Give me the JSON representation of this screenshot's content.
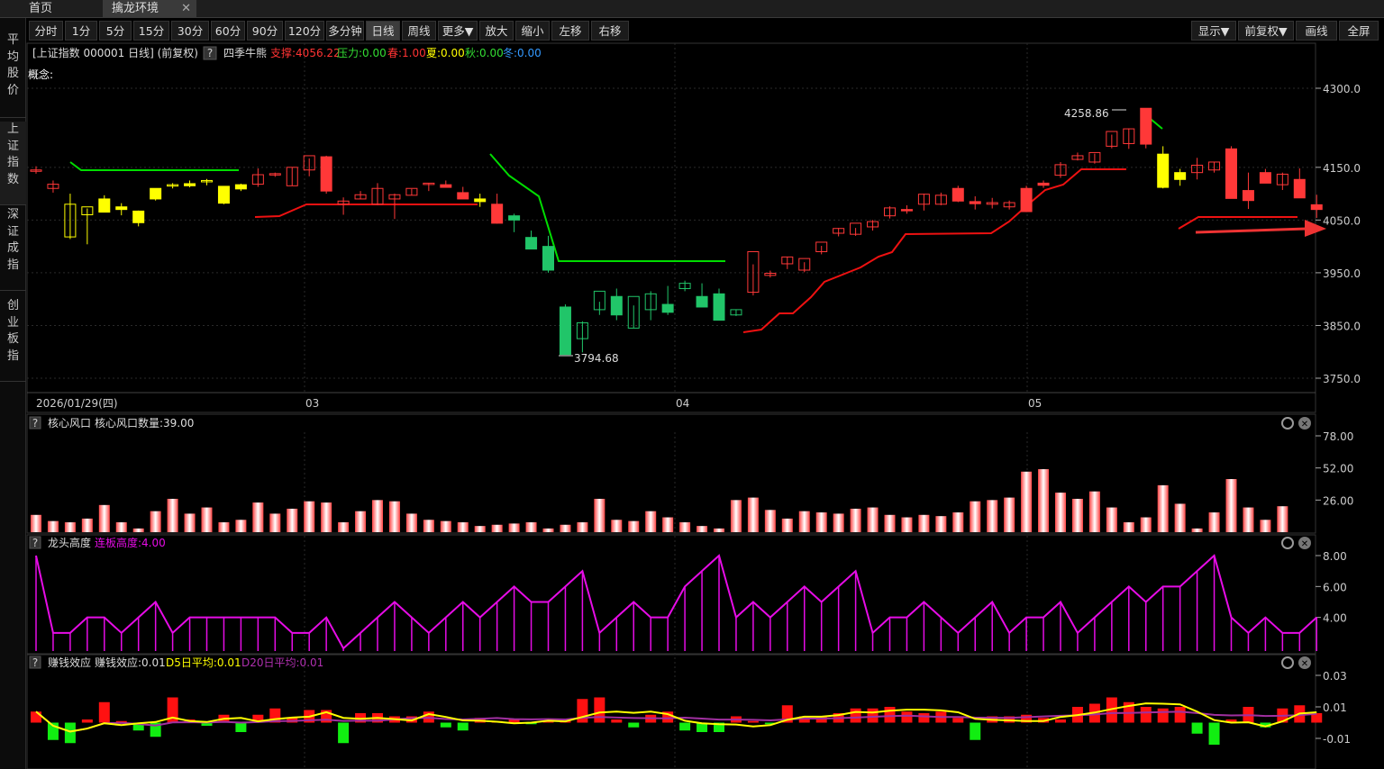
{
  "tabs": {
    "home": "首页",
    "env": "擒龙环境",
    "close": "✕"
  },
  "sidebar": [
    "平\n均\n股\n价",
    "上\n证\n指\n数",
    "深\n证\n成\n指",
    "创\n业\n板\n指"
  ],
  "toolbar": {
    "left": [
      "分时",
      "1分",
      "5分",
      "15分",
      "30分",
      "60分",
      "90分",
      "120分",
      "多分钟",
      "日线",
      "周线",
      "更多▼",
      "放大",
      "缩小",
      "左移",
      "右移"
    ],
    "active": "日线",
    "right": [
      "显示▼",
      "前复权▼",
      "画线",
      "全屏"
    ]
  },
  "colors": {
    "up": "#ff3838",
    "down": "#21c569",
    "yellow": "#ffff00",
    "magenta": "#e60ce6",
    "green_line": "#00dd00",
    "red_line": "#ee1111"
  },
  "main": {
    "title": "[上证指数 000001 日线] (前复权)",
    "indicator_name": "四季牛熊",
    "help": "?",
    "support": "支撑:4056.22",
    "pressure": "压力:0.00",
    "spring": "春:1.00",
    "summer": "夏:0.00",
    "autumn": "秋:0.00",
    "winter": "冬:0.00",
    "concept": "概念:",
    "high_label": "4258.86",
    "low_label": "3794.68"
  },
  "x_labels": {
    "first": "2026/01/29(四)",
    "m3": "03",
    "m4": "04",
    "m5": "05"
  },
  "panels": [
    {
      "label": "核心风口",
      "value": "核心风口数量:39.00",
      "yticks": [
        "78.00",
        "52.00",
        "26.00"
      ]
    },
    {
      "label": "龙头高度",
      "value": "连板高度:4.00",
      "yticks": [
        "8.00",
        "6.00",
        "4.00"
      ]
    },
    {
      "label": "赚钱效应",
      "value": "赚钱效应:0.01",
      "d5": "D5日平均:0.01",
      "d20": "D20日平均:0.01",
      "yticks": [
        "0.03",
        "0.01",
        "-0.01"
      ]
    }
  ],
  "chart_data": {
    "type": "candlestick",
    "y_ticks": [
      4300,
      4150,
      4050,
      3950,
      3850,
      3750
    ],
    "ohlc": [
      [
        4145,
        4152,
        4138,
        4145
      ],
      [
        4110,
        4125,
        4102,
        4118
      ],
      [
        4080,
        4100,
        4014,
        4018
      ],
      [
        4060,
        4072,
        4004,
        4075
      ],
      [
        4090,
        4097,
        4068,
        4065
      ],
      [
        4075,
        4082,
        4059,
        4070
      ],
      [
        4045,
        4068,
        4038,
        4067
      ],
      [
        4090,
        4103,
        4087,
        4110
      ],
      [
        4115,
        4120,
        4110,
        4117
      ],
      [
        4115,
        4125,
        4112,
        4119
      ],
      [
        4125,
        4128,
        4116,
        4123
      ],
      [
        4082,
        4112,
        4080,
        4114
      ],
      [
        4109,
        4119,
        4105,
        4117
      ],
      [
        4118,
        4148,
        4113,
        4136
      ],
      [
        4136,
        4140,
        4132,
        4138
      ],
      [
        4115,
        4150,
        4115,
        4150
      ],
      [
        4145,
        4167,
        4133,
        4172
      ],
      [
        4170,
        4172,
        4100,
        4105
      ],
      [
        4080,
        4093,
        4060,
        4086
      ],
      [
        4090,
        4105,
        4090,
        4098
      ],
      [
        4080,
        4120,
        4078,
        4110
      ],
      [
        4090,
        4100,
        4052,
        4098
      ],
      [
        4097,
        4109,
        4097,
        4110
      ],
      [
        4118,
        4120,
        4105,
        4120
      ],
      [
        4117,
        4125,
        4112,
        4112
      ],
      [
        4102,
        4113,
        4094,
        4090
      ],
      [
        4090,
        4100,
        4075,
        4085
      ],
      [
        4080,
        4100,
        4043,
        4044
      ],
      [
        4058,
        4062,
        4027,
        4050
      ],
      [
        4017,
        4030,
        3995,
        3995
      ],
      [
        4000,
        4020,
        3950,
        3955
      ],
      [
        3885,
        3890,
        3795,
        3795
      ],
      [
        3825,
        3858,
        3799,
        3855
      ],
      [
        3880,
        3895,
        3870,
        3915
      ],
      [
        3905,
        3920,
        3860,
        3870
      ],
      [
        3845,
        3888,
        3845,
        3905
      ],
      [
        3880,
        3915,
        3860,
        3910
      ],
      [
        3890,
        3925,
        3870,
        3875
      ],
      [
        3920,
        3935,
        3915,
        3930
      ],
      [
        3905,
        3930,
        3898,
        3885
      ],
      [
        3910,
        3920,
        3860,
        3860
      ],
      [
        3870,
        3880,
        3868,
        3880
      ],
      [
        3913,
        3966,
        3907,
        3990
      ],
      [
        3945,
        3954,
        3941,
        3949
      ],
      [
        3967,
        3980,
        3957,
        3980
      ],
      [
        3955,
        3970,
        3951,
        3977
      ],
      [
        3990,
        4001,
        3985,
        4008
      ],
      [
        4025,
        4035,
        4019,
        4034
      ],
      [
        4023,
        4035,
        4020,
        4044
      ],
      [
        4037,
        4050,
        4030,
        4047
      ],
      [
        4058,
        4076,
        4053,
        4073
      ],
      [
        4070,
        4078,
        4062,
        4068
      ],
      [
        4080,
        4100,
        4068,
        4099
      ],
      [
        4080,
        4102,
        4078,
        4097
      ],
      [
        4110,
        4115,
        4084,
        4086
      ],
      [
        4085,
        4095,
        4070,
        4081
      ],
      [
        4080,
        4092,
        4072,
        4083
      ],
      [
        4075,
        4087,
        4070,
        4083
      ],
      [
        4110,
        4115,
        4065,
        4066
      ],
      [
        4120,
        4125,
        4111,
        4116
      ],
      [
        4135,
        4160,
        4130,
        4155
      ],
      [
        4165,
        4178,
        4163,
        4172
      ],
      [
        4160,
        4176,
        4157,
        4178
      ],
      [
        4190,
        4212,
        4186,
        4218
      ],
      [
        4195,
        4224,
        4185,
        4223
      ],
      [
        4262,
        4258,
        4186,
        4194
      ],
      [
        4175,
        4190,
        4110,
        4112
      ],
      [
        4140,
        4147,
        4115,
        4127
      ],
      [
        4140,
        4168,
        4127,
        4154
      ],
      [
        4145,
        4160,
        4140,
        4160
      ],
      [
        4185,
        4190,
        4100,
        4091
      ],
      [
        4106,
        4140,
        4071,
        4087
      ],
      [
        4140,
        4147,
        4122,
        4120
      ],
      [
        4117,
        4140,
        4107,
        4137
      ],
      [
        4127,
        4148,
        4101,
        4092
      ],
      [
        4079,
        4098,
        4054,
        4070
      ]
    ],
    "support_line": "red line rising from ~3845 to ~4140, ends ~4056",
    "pressure_lines": "green line segments",
    "core_windows": [
      14,
      9,
      8,
      11,
      22,
      8,
      3,
      17,
      27,
      15,
      20,
      8,
      10,
      24,
      15,
      19,
      25,
      24,
      8,
      17,
      26,
      25,
      15,
      10,
      9,
      8,
      5,
      6,
      7,
      8,
      3,
      6,
      8,
      27,
      10,
      9,
      17,
      12,
      8,
      5,
      3,
      26,
      28,
      18,
      11,
      17,
      16,
      15,
      19,
      20,
      14,
      12,
      14,
      13,
      16,
      25,
      26,
      28,
      49,
      51,
      32,
      27,
      33,
      20,
      8,
      12,
      38,
      23,
      3,
      16,
      43,
      20,
      10,
      21
    ],
    "dragon_height": [
      8,
      3,
      3,
      4,
      4,
      3,
      4,
      5,
      3,
      4,
      4,
      4,
      4,
      4,
      4,
      3,
      3,
      4,
      2,
      3,
      4,
      5,
      4,
      3,
      4,
      5,
      4,
      5,
      6,
      5,
      5,
      6,
      7,
      3,
      4,
      5,
      4,
      4,
      6,
      7,
      8,
      4,
      5,
      4,
      5,
      6,
      5,
      6,
      7,
      3,
      4,
      4,
      5,
      4,
      3,
      4,
      5,
      3,
      4,
      4,
      5,
      3,
      4,
      5,
      6,
      5,
      6,
      6,
      7,
      8,
      4,
      3,
      4,
      3,
      3,
      4
    ],
    "money_effect": [
      0.007,
      -0.011,
      -0.013,
      0.002,
      0.013,
      0.001,
      -0.005,
      -0.009,
      0.016,
      0.002,
      -0.002,
      0.005,
      -0.006,
      0.005,
      0.009,
      0.003,
      0.008,
      0.008,
      -0.013,
      0.006,
      0.006,
      0.004,
      0.004,
      0.007,
      -0.003,
      -0.005,
      0.003,
      0.001,
      0.002,
      -0.001,
      0.001,
      0.001,
      0.015,
      0.016,
      0.002,
      -0.003,
      0.005,
      0.007,
      -0.005,
      -0.006,
      -0.006,
      0.004,
      0.001,
      -0.001,
      0.011,
      0.004,
      0.004,
      0.006,
      0.009,
      0.009,
      0.01,
      0.007,
      0.006,
      0.007,
      0.003,
      -0.011,
      0.004,
      0.004,
      0.005,
      0.003,
      0.002,
      0.01,
      0.012,
      0.016,
      0.013,
      0.01,
      0.009,
      0.01,
      -0.007,
      -0.014,
      0.002,
      0.01,
      -0.003,
      0.009,
      0.011,
      0.006,
      0.004,
      0.003,
      0.006
    ]
  }
}
